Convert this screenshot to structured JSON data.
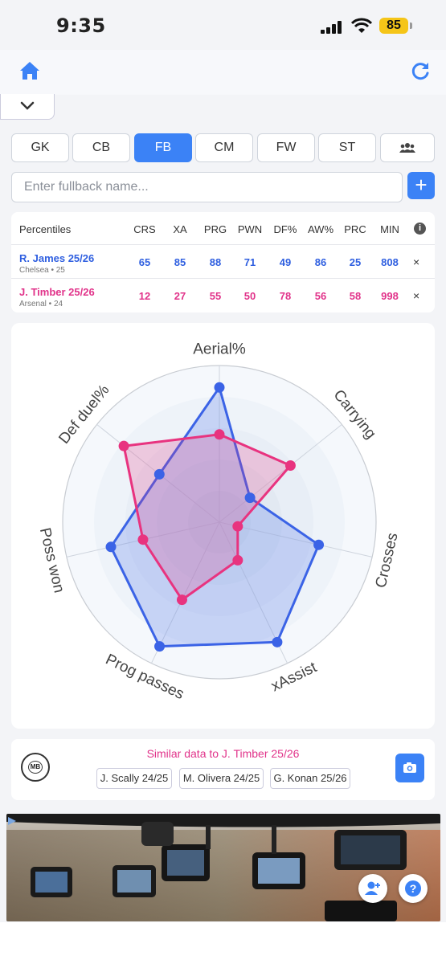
{
  "status": {
    "time": "9:35",
    "battery": "85"
  },
  "positions": [
    "GK",
    "CB",
    "FB",
    "CM",
    "FW",
    "ST"
  ],
  "active_position": "FB",
  "search": {
    "placeholder": "Enter fullback name...",
    "add_label": "+"
  },
  "table": {
    "header_label": "Percentiles",
    "columns": [
      "CRS",
      "XA",
      "PRG",
      "PWN",
      "DF%",
      "AW%",
      "PRC",
      "MIN"
    ],
    "rows": [
      {
        "name": "R. James 25/26",
        "sub": "Chelsea • 25",
        "color": "#2f5fe0",
        "values": [
          "65",
          "85",
          "88",
          "71",
          "49",
          "86",
          "25",
          "808"
        ],
        "remove": "×"
      },
      {
        "name": "J. Timber 25/26",
        "sub": "Arsenal • 24",
        "color": "#e1338a",
        "values": [
          "12",
          "27",
          "55",
          "50",
          "78",
          "56",
          "58",
          "998"
        ],
        "remove": "×"
      }
    ]
  },
  "chart_data": {
    "type": "radar",
    "axes": [
      "Aerial%",
      "Carrying",
      "Crosses",
      "xAssist",
      "Prog passes",
      "Poss won",
      "Def duel%"
    ],
    "range": [
      0,
      100
    ],
    "series": [
      {
        "name": "R. James 25/26",
        "color": "#3b63e6",
        "values": [
          86,
          25,
          65,
          85,
          88,
          71,
          49
        ]
      },
      {
        "name": "J. Timber 25/26",
        "color": "#e8337f",
        "values": [
          56,
          58,
          12,
          27,
          55,
          50,
          78
        ]
      }
    ]
  },
  "similar": {
    "title": "Similar data to J. Timber 25/26",
    "chips": [
      "J. Scally 24/25",
      "M. Olivera 24/25",
      "G. Konan 25/26"
    ],
    "logo": "MB"
  },
  "icons": {
    "home": "home-icon",
    "refresh": "refresh-icon",
    "chevron": "chevron-down-icon",
    "team": "team-icon",
    "info": "info-icon",
    "camera": "camera-icon",
    "add_user": "add-user-icon",
    "help": "help-icon"
  },
  "accent": "#3b82f6",
  "help_label": "?",
  "info_label": "i"
}
